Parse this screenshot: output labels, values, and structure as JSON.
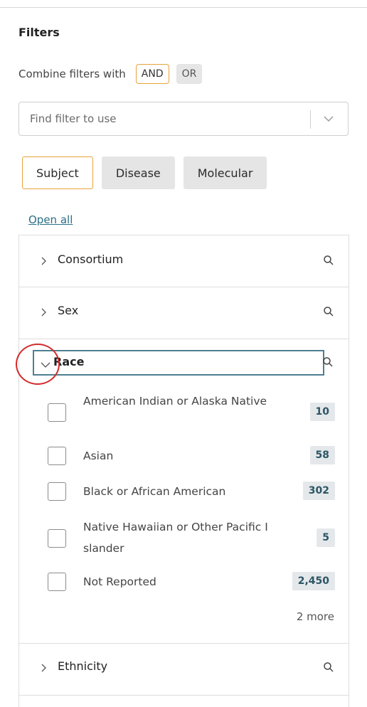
{
  "filters": {
    "title": "Filters",
    "combine_label": "Combine filters with",
    "operators": [
      {
        "label": "AND",
        "selected": true
      },
      {
        "label": "OR",
        "selected": false
      }
    ],
    "find_placeholder": "Find filter to use",
    "tabs": [
      {
        "label": "Subject",
        "selected": true
      },
      {
        "label": "Disease",
        "selected": false
      },
      {
        "label": "Molecular",
        "selected": false
      }
    ],
    "open_all": "Open all"
  },
  "facets": {
    "consortium": {
      "title": "Consortium",
      "expanded": false
    },
    "sex": {
      "title": "Sex",
      "expanded": false
    },
    "race": {
      "title": "Race",
      "expanded": true,
      "options": [
        {
          "label": "American Indian or Alaska Native",
          "count": "10"
        },
        {
          "label": "Asian",
          "count": "58"
        },
        {
          "label": "Black or African American",
          "count": "302"
        },
        {
          "label": "Native Hawaiian or Other Pacific Islander",
          "count": "5"
        },
        {
          "label": "Not Reported",
          "count": "2,450"
        }
      ],
      "more": "2 more"
    },
    "ethnicity": {
      "title": "Ethnicity",
      "expanded": false
    }
  },
  "colors": {
    "accent": "#e8a33c",
    "link": "#2a6f86",
    "focus_border": "#4e7f90",
    "annotation": "#d42a2a"
  },
  "icons": [
    "chevron-down-icon",
    "chevron-right-icon",
    "search-icon"
  ]
}
